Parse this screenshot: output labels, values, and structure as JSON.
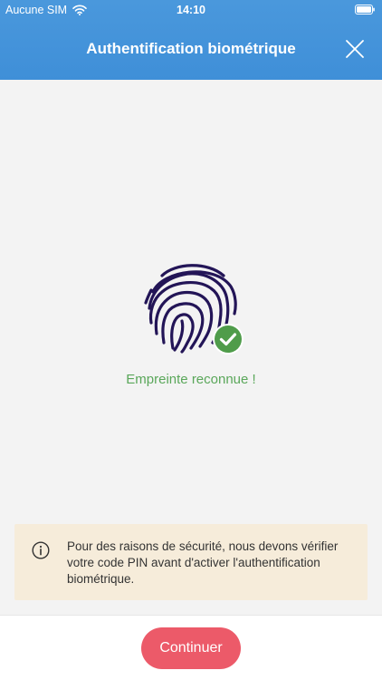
{
  "status_bar": {
    "carrier": "Aucune SIM",
    "time": "14:10",
    "wifi_icon": "wifi-icon",
    "battery_icon": "battery-icon"
  },
  "header": {
    "title": "Authentification biométrique",
    "close_icon": "close-icon",
    "background_color": "#4a98dc"
  },
  "main": {
    "fingerprint_icon": "fingerprint-icon",
    "check_icon": "check-circle-icon",
    "status_text": "Empreinte reconnue !",
    "status_color": "#5aa75a"
  },
  "info": {
    "icon": "info-icon",
    "text": "Pour des raisons de sécurité, nous devons vérifier votre code PIN avant d'activer l'authentification biométrique.",
    "background_color": "#f6ecda"
  },
  "footer": {
    "continue_label": "Continuer",
    "button_color": "#ec5a69"
  }
}
